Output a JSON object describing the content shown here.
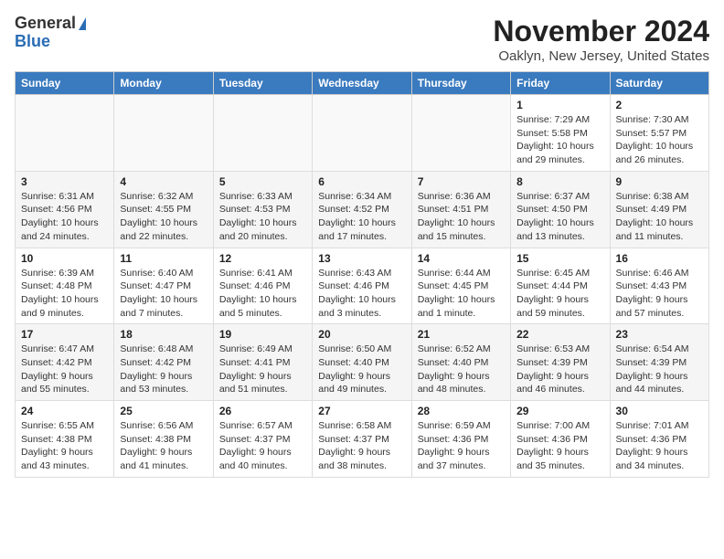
{
  "header": {
    "logo_general": "General",
    "logo_blue": "Blue",
    "month": "November 2024",
    "location": "Oaklyn, New Jersey, United States"
  },
  "columns": [
    "Sunday",
    "Monday",
    "Tuesday",
    "Wednesday",
    "Thursday",
    "Friday",
    "Saturday"
  ],
  "weeks": [
    [
      {
        "day": "",
        "info": ""
      },
      {
        "day": "",
        "info": ""
      },
      {
        "day": "",
        "info": ""
      },
      {
        "day": "",
        "info": ""
      },
      {
        "day": "",
        "info": ""
      },
      {
        "day": "1",
        "info": "Sunrise: 7:29 AM\nSunset: 5:58 PM\nDaylight: 10 hours\nand 29 minutes."
      },
      {
        "day": "2",
        "info": "Sunrise: 7:30 AM\nSunset: 5:57 PM\nDaylight: 10 hours\nand 26 minutes."
      }
    ],
    [
      {
        "day": "3",
        "info": "Sunrise: 6:31 AM\nSunset: 4:56 PM\nDaylight: 10 hours\nand 24 minutes."
      },
      {
        "day": "4",
        "info": "Sunrise: 6:32 AM\nSunset: 4:55 PM\nDaylight: 10 hours\nand 22 minutes."
      },
      {
        "day": "5",
        "info": "Sunrise: 6:33 AM\nSunset: 4:53 PM\nDaylight: 10 hours\nand 20 minutes."
      },
      {
        "day": "6",
        "info": "Sunrise: 6:34 AM\nSunset: 4:52 PM\nDaylight: 10 hours\nand 17 minutes."
      },
      {
        "day": "7",
        "info": "Sunrise: 6:36 AM\nSunset: 4:51 PM\nDaylight: 10 hours\nand 15 minutes."
      },
      {
        "day": "8",
        "info": "Sunrise: 6:37 AM\nSunset: 4:50 PM\nDaylight: 10 hours\nand 13 minutes."
      },
      {
        "day": "9",
        "info": "Sunrise: 6:38 AM\nSunset: 4:49 PM\nDaylight: 10 hours\nand 11 minutes."
      }
    ],
    [
      {
        "day": "10",
        "info": "Sunrise: 6:39 AM\nSunset: 4:48 PM\nDaylight: 10 hours\nand 9 minutes."
      },
      {
        "day": "11",
        "info": "Sunrise: 6:40 AM\nSunset: 4:47 PM\nDaylight: 10 hours\nand 7 minutes."
      },
      {
        "day": "12",
        "info": "Sunrise: 6:41 AM\nSunset: 4:46 PM\nDaylight: 10 hours\nand 5 minutes."
      },
      {
        "day": "13",
        "info": "Sunrise: 6:43 AM\nSunset: 4:46 PM\nDaylight: 10 hours\nand 3 minutes."
      },
      {
        "day": "14",
        "info": "Sunrise: 6:44 AM\nSunset: 4:45 PM\nDaylight: 10 hours\nand 1 minute."
      },
      {
        "day": "15",
        "info": "Sunrise: 6:45 AM\nSunset: 4:44 PM\nDaylight: 9 hours\nand 59 minutes."
      },
      {
        "day": "16",
        "info": "Sunrise: 6:46 AM\nSunset: 4:43 PM\nDaylight: 9 hours\nand 57 minutes."
      }
    ],
    [
      {
        "day": "17",
        "info": "Sunrise: 6:47 AM\nSunset: 4:42 PM\nDaylight: 9 hours\nand 55 minutes."
      },
      {
        "day": "18",
        "info": "Sunrise: 6:48 AM\nSunset: 4:42 PM\nDaylight: 9 hours\nand 53 minutes."
      },
      {
        "day": "19",
        "info": "Sunrise: 6:49 AM\nSunset: 4:41 PM\nDaylight: 9 hours\nand 51 minutes."
      },
      {
        "day": "20",
        "info": "Sunrise: 6:50 AM\nSunset: 4:40 PM\nDaylight: 9 hours\nand 49 minutes."
      },
      {
        "day": "21",
        "info": "Sunrise: 6:52 AM\nSunset: 4:40 PM\nDaylight: 9 hours\nand 48 minutes."
      },
      {
        "day": "22",
        "info": "Sunrise: 6:53 AM\nSunset: 4:39 PM\nDaylight: 9 hours\nand 46 minutes."
      },
      {
        "day": "23",
        "info": "Sunrise: 6:54 AM\nSunset: 4:39 PM\nDaylight: 9 hours\nand 44 minutes."
      }
    ],
    [
      {
        "day": "24",
        "info": "Sunrise: 6:55 AM\nSunset: 4:38 PM\nDaylight: 9 hours\nand 43 minutes."
      },
      {
        "day": "25",
        "info": "Sunrise: 6:56 AM\nSunset: 4:38 PM\nDaylight: 9 hours\nand 41 minutes."
      },
      {
        "day": "26",
        "info": "Sunrise: 6:57 AM\nSunset: 4:37 PM\nDaylight: 9 hours\nand 40 minutes."
      },
      {
        "day": "27",
        "info": "Sunrise: 6:58 AM\nSunset: 4:37 PM\nDaylight: 9 hours\nand 38 minutes."
      },
      {
        "day": "28",
        "info": "Sunrise: 6:59 AM\nSunset: 4:36 PM\nDaylight: 9 hours\nand 37 minutes."
      },
      {
        "day": "29",
        "info": "Sunrise: 7:00 AM\nSunset: 4:36 PM\nDaylight: 9 hours\nand 35 minutes."
      },
      {
        "day": "30",
        "info": "Sunrise: 7:01 AM\nSunset: 4:36 PM\nDaylight: 9 hours\nand 34 minutes."
      }
    ]
  ]
}
